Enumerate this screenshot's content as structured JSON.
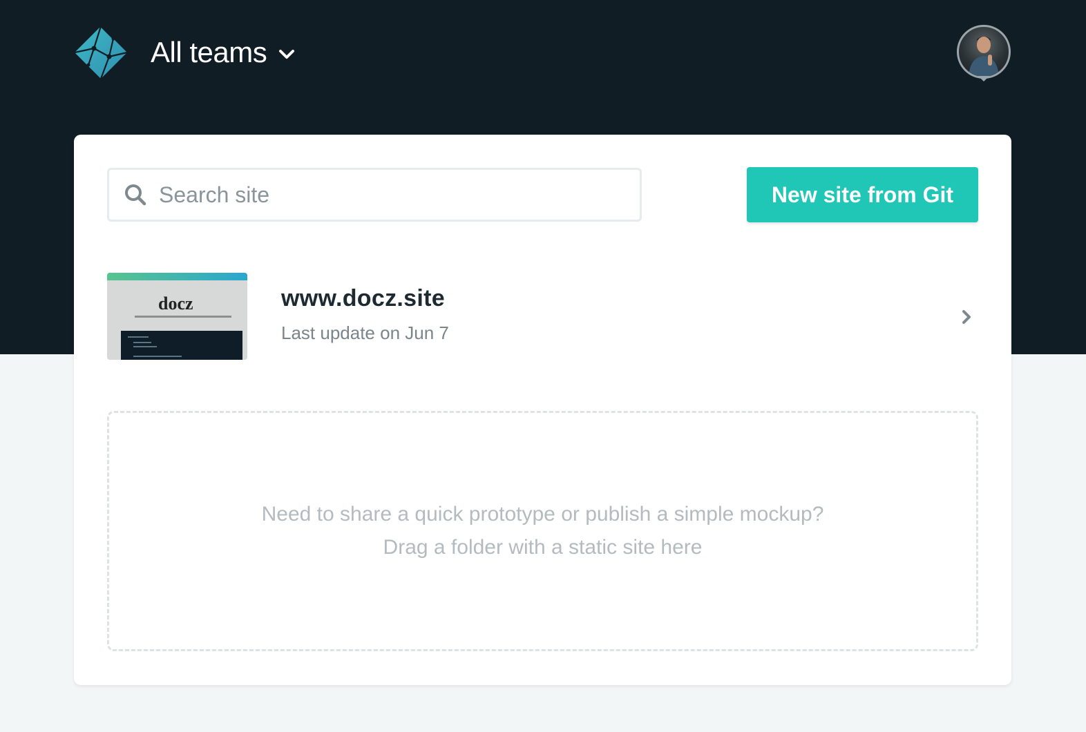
{
  "header": {
    "logo_icon": "netlify-logo-icon",
    "team_label": "All teams",
    "team_dropdown_icon": "chevron-down-icon",
    "avatar_icon": "user-avatar"
  },
  "toolbar": {
    "search": {
      "placeholder": "Search site",
      "value": "",
      "icon": "search-icon"
    },
    "new_site_label": "New site from Git"
  },
  "sites": [
    {
      "name": "www.docz.site",
      "updated": "Last update on Jun 7",
      "thumbnail_brand": "docz",
      "chevron_icon": "chevron-right-icon"
    }
  ],
  "dropzone": {
    "line1": "Need to share a quick prototype or publish a simple mockup?",
    "line2": "Drag a folder with a static site here"
  },
  "colors": {
    "header_bg": "#111d25",
    "page_bg": "#f3f6f7",
    "accent": "#20c6b6",
    "card_bg": "#ffffff"
  }
}
